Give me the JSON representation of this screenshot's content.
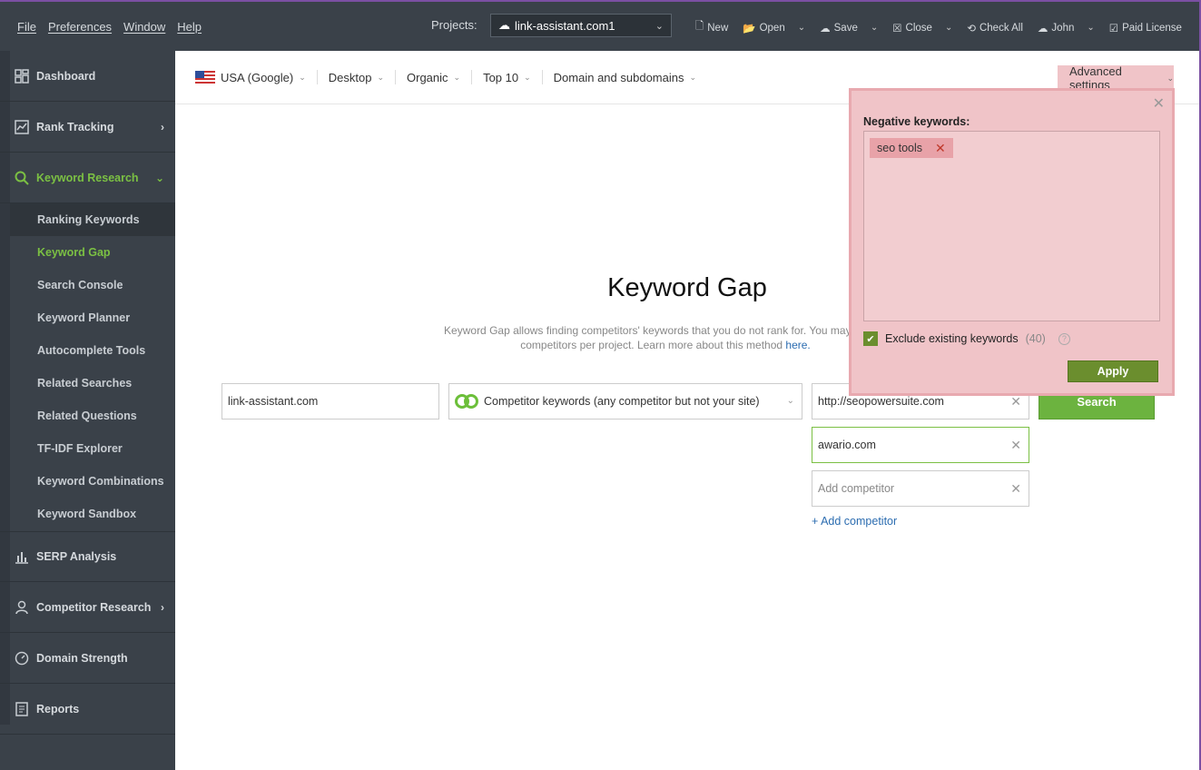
{
  "menu": [
    "File",
    "Preferences",
    "Window",
    "Help"
  ],
  "projects": {
    "label": "Projects:",
    "current": "link-assistant.com1"
  },
  "tools": [
    {
      "icon": "new-icon",
      "label": "New"
    },
    {
      "icon": "open-icon",
      "label": "Open"
    },
    {
      "icon": "save-icon",
      "label": "Save"
    },
    {
      "icon": "close-icon",
      "label": "Close"
    },
    {
      "icon": "check-all-icon",
      "label": "Check All"
    },
    {
      "icon": "user-icon",
      "label": "John"
    },
    {
      "icon": "license-icon",
      "label": "Paid License"
    }
  ],
  "sidebar": {
    "sections": [
      {
        "label": "Dashboard",
        "icon": "dashboard-icon"
      },
      {
        "label": "Rank Tracking",
        "icon": "chart-line-icon"
      },
      {
        "label": "Keyword Research",
        "icon": "search-icon"
      },
      {
        "label": "SERP Analysis",
        "icon": "bar-chart-icon"
      },
      {
        "label": "Competitor Research",
        "icon": "person-icon"
      },
      {
        "label": "Domain Strength",
        "icon": "gauge-icon"
      },
      {
        "label": "Reports",
        "icon": "report-icon"
      }
    ],
    "sub": [
      "Ranking Keywords",
      "Keyword Gap",
      "Search Console",
      "Keyword Planner",
      "Autocomplete Tools",
      "Related Searches",
      "Related Questions",
      "TF-IDF Explorer",
      "Keyword Combinations",
      "Keyword Sandbox"
    ]
  },
  "filters": [
    "USA (Google)",
    "Desktop",
    "Organic",
    "Top 10",
    "Domain and subdomains"
  ],
  "advanced": "Advanced settings",
  "main": {
    "title": "Keyword Gap",
    "desc1": "Keyword Gap allows finding competitors' keywords that you do not rank for. You may compa",
    "desc2": "competitors per project. Learn more about this method ",
    "desc_link": "here.",
    "site": "link-assistant.com",
    "mode": "Competitor keywords (any competitor but not your site)",
    "comp1": "http://seopowersuite.com",
    "comp2": "awario.com",
    "comp_placeholder": "Add competitor",
    "add_link": "+ Add competitor",
    "search": "Search"
  },
  "popup": {
    "label": "Negative keywords:",
    "tag": "seo tools",
    "exclude": "Exclude existing keywords",
    "count": "(40)",
    "help": "?",
    "apply": "Apply"
  }
}
